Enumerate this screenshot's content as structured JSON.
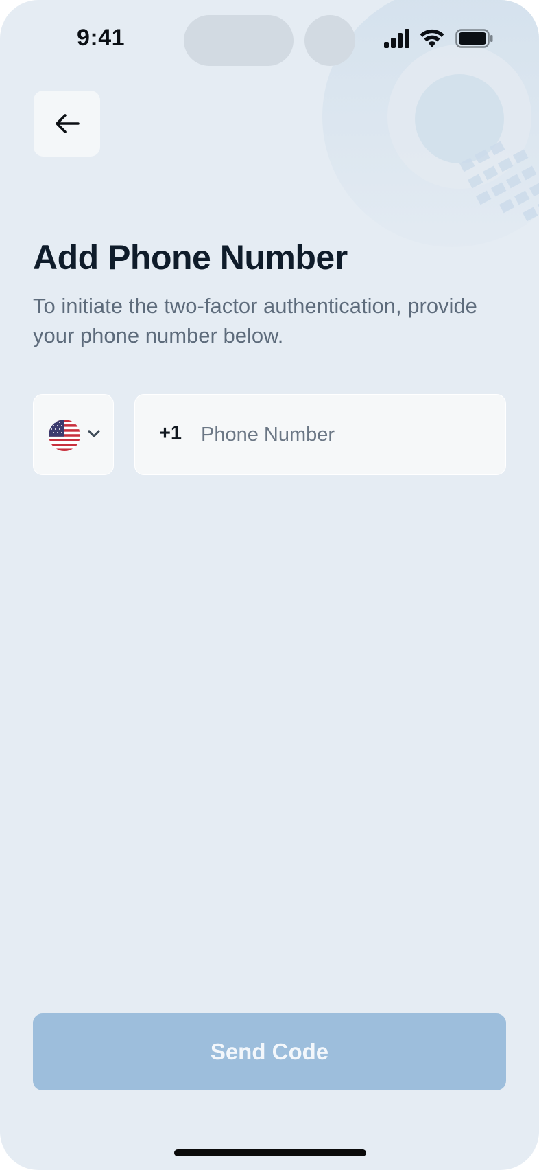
{
  "status_bar": {
    "time": "9:41",
    "icons": [
      "signal-icon",
      "wifi-icon",
      "battery-icon"
    ]
  },
  "header": {
    "back_icon": "arrow-left-icon"
  },
  "main": {
    "title": "Add Phone Number",
    "subtitle": "To initiate the two-factor authentication, provide your phone number below."
  },
  "phone_form": {
    "country": {
      "flag_icon": "us-flag-icon",
      "dropdown_icon": "chevron-down-icon"
    },
    "dial_code": "+1",
    "phone_value": "",
    "phone_placeholder": "Phone Number"
  },
  "footer": {
    "send_label": "Send Code"
  },
  "colors": {
    "background": "#e5ecf3",
    "field_background": "#f6f8f9",
    "button_disabled": "#9dbedc",
    "title": "#0f1c2a",
    "subtitle": "#5d6b7b"
  }
}
